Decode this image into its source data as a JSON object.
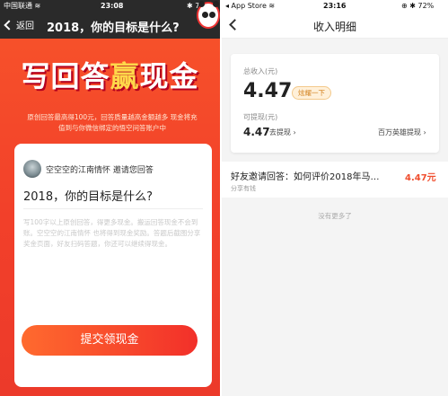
{
  "left": {
    "status": {
      "carrier": "中国联通 ≋",
      "time": "23:08",
      "battery": "✱ 74%"
    },
    "nav": {
      "back_label": "返回",
      "title": "2018，你的目标是什么?"
    },
    "banner": {
      "part1": "写回答",
      "part2": "赢",
      "part3": "现金"
    },
    "subtitle": "原创回答最高得100元，回答质量越高金额越多 现金将充值到与你微信绑定的悟空问答账户中",
    "card": {
      "inviter": "空空空的江南情怀 邀请您回答",
      "question": "2018，你的目标是什么?",
      "hint": "写100字以上原创回答，得更多现金。搬运回答现金不会到账。空空空的江南情怀 也将得到现金奖励。答题后截图分享奖金页面，好友扫码答题，你还可以继续得现金。"
    },
    "submit_label": "提交领现金"
  },
  "right": {
    "status": {
      "source": "◂ App Store ≋",
      "time": "23:16",
      "battery": "⊕ ✱ 72%"
    },
    "nav": {
      "title": "收入明细"
    },
    "income": {
      "total_label": "总收入(元)",
      "total": "4.47",
      "badge": "炫耀一下",
      "available_label": "可提现(元)",
      "available": "4.47",
      "withdraw": "去提现 ›",
      "hero_withdraw": "百万英雄提现 ›"
    },
    "record": {
      "title": "好友邀请回答：如何评价2018年马…",
      "sub": "分享有钱",
      "amount": "4.47元"
    },
    "no_more": "没有更多了"
  },
  "colors": {
    "accent": "#f04e2e",
    "badge_text": "#d2801c"
  }
}
